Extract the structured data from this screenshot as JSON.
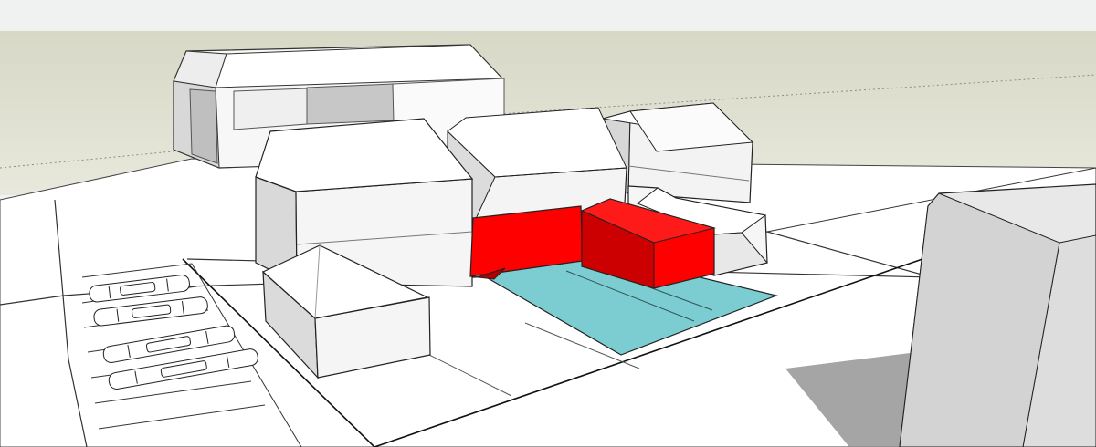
{
  "window": {
    "title": ""
  },
  "scene": {
    "sky_color": "#dbdbc9",
    "ground_color": "#ffffff",
    "top_bar_color": "#f0f1f1",
    "highlight_red": "#ff0000",
    "highlight_blue": "#7ccdd1"
  },
  "objects": {
    "buildings": [
      "background-long-building",
      "left-house",
      "center-house",
      "right-house",
      "small-front-house",
      "red-extension",
      "red-wing",
      "small-back-house",
      "right-side-block"
    ],
    "site_features": [
      "blue-plot",
      "parking-bays",
      "road-edges",
      "shadow-area"
    ]
  }
}
